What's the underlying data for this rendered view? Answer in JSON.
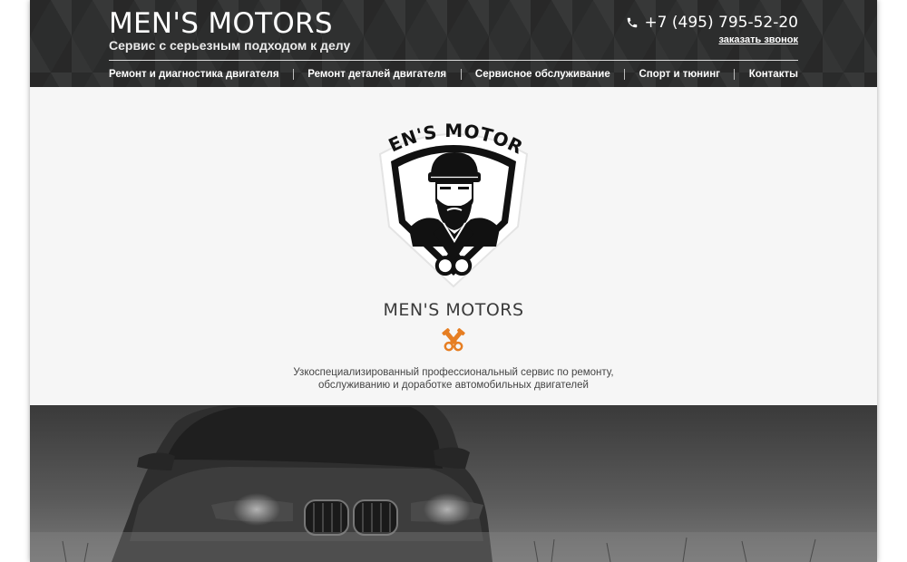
{
  "header": {
    "brand_title": "MEN'S MOTORS",
    "tagline": "Сервис с серьезным подходом к делу",
    "phone": "+7 (495) 795-52-20",
    "callback_link": "заказать звонок",
    "phone_icon": "phone-icon"
  },
  "nav": {
    "items": [
      {
        "label": "Ремонт и диагностика двигателя"
      },
      {
        "label": "Ремонт деталей двигателя"
      },
      {
        "label": "Сервисное обслуживание"
      },
      {
        "label": "Спорт и тюнинг"
      },
      {
        "label": "Контакты"
      }
    ]
  },
  "hero": {
    "logo_text": "MEN'S MOTORS",
    "title": "MEN'S MOTORS",
    "divider_icon": "crossed-pistons-icon",
    "description_line1": "Узкоспециализированный профессиональный сервис по ремонту,",
    "description_line2": "обслуживанию и доработке автомобильных двигателей"
  },
  "banner": {
    "image": "car-photo"
  },
  "colors": {
    "header_bg": "#2f3030",
    "hero_bg": "#f6f6f6",
    "accent": "#e67e22",
    "text": "#3b3b3b"
  }
}
